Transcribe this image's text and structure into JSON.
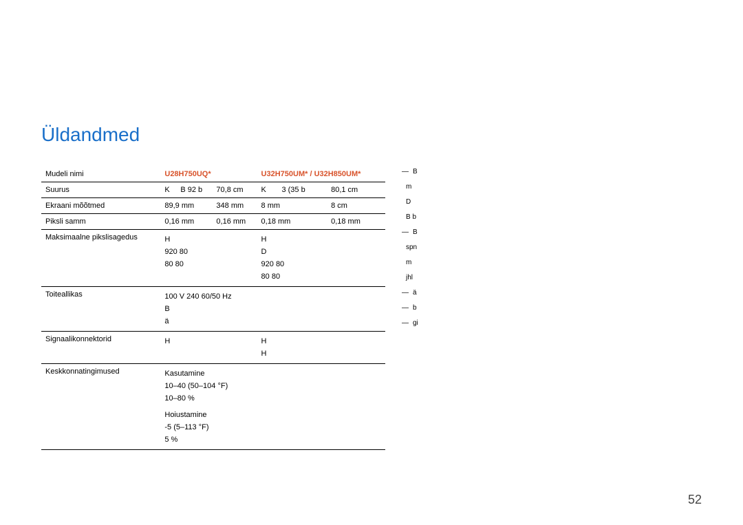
{
  "page_number": "52",
  "heading": "Üldandmed",
  "table": {
    "header": {
      "label": "Mudeli nimi",
      "model1": "U28H750UQ*",
      "model2": "U32H750UM* / U32H850UM*"
    },
    "rows": {
      "size": {
        "label": "Suurus",
        "v1a": "K",
        "v1b": "B  92  b",
        "v1c": "70,8  cm",
        "v2a": "K",
        "v2b": "3  (35  b",
        "v2c": "80,1  cm"
      },
      "screen": {
        "label": "Ekraani mõõtmed",
        "v1a": "89,9  mm",
        "v1b": "348 mm",
        "v2a": "8  mm",
        "v2b": "8  cm"
      },
      "pixel": {
        "label": "Piksli samm",
        "v1a": "0,16  mm",
        "v1b": "0,16  mm",
        "v2a": "0,18 mm",
        "v2b": "0,18 mm"
      },
      "clock": {
        "label": "Maksimaalne pikslisagedus",
        "v1_line1": "H",
        "v1_line2": "920  80",
        "v1_line3": "80  80",
        "v2_line1": "H",
        "v2_line2": "D",
        "v2_line3": "920  80",
        "v2_line4": "80  80"
      },
      "power": {
        "label": "Toiteallikas",
        "line1": "100 V 240 60/50 Hz",
        "line2": "B",
        "line3": "ä"
      },
      "signal": {
        "label": "Signaalikonnektorid",
        "v1_line1": "H",
        "v2_line1": "H",
        "v2_line2": "H"
      },
      "env": {
        "label": "Keskkonnatingimused",
        "use_label": "Kasutamine",
        "use_temp": "10–40  (50–104  °F)",
        "use_hum": "10–80 %",
        "store_label": "Hoiustamine",
        "store_temp": "-5  (5–113  °F)",
        "store_hum": "5 %"
      }
    }
  },
  "notes": [
    "B",
    "m",
    "D",
    "B  b",
    "B",
    "spn",
    "m",
    "jhl",
    "ä",
    "b",
    "gi"
  ]
}
